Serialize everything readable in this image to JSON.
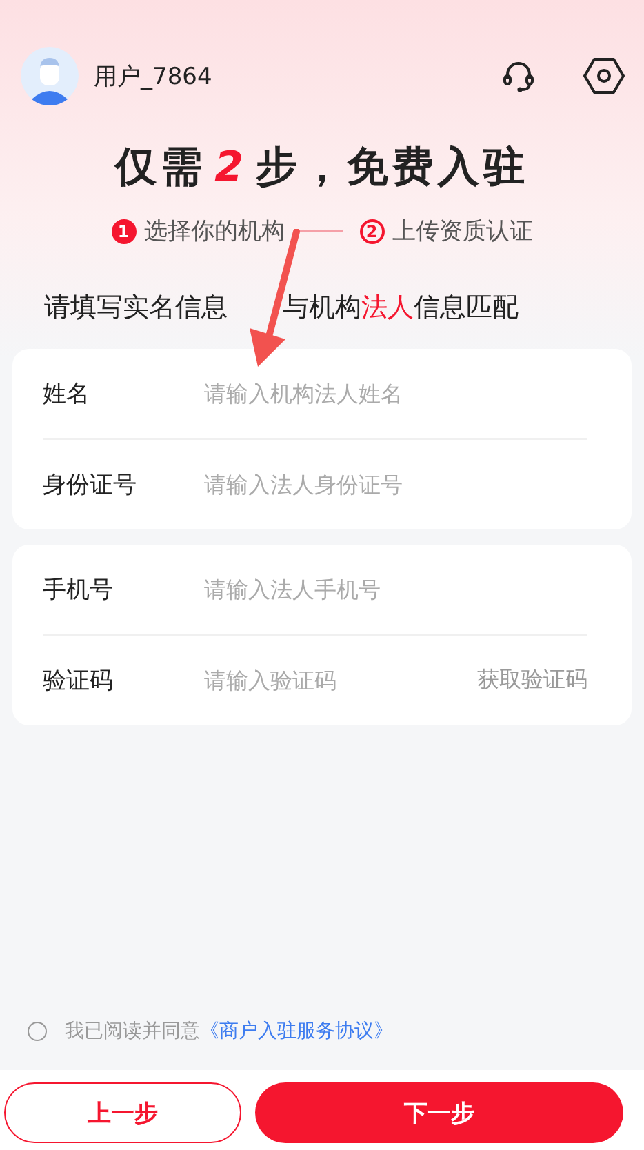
{
  "header": {
    "username": "用户_7864"
  },
  "title": {
    "before": "仅需",
    "number": "2",
    "after": "步，免费入驻"
  },
  "steps": [
    {
      "number": "1",
      "label": "选择你的机构",
      "selected": true
    },
    {
      "number": "2",
      "label": "上传资质认证",
      "selected": false
    }
  ],
  "instruction": [
    {
      "text": "请填写实名信息",
      "highlight": false
    },
    {
      "text": "与机构",
      "highlight": false
    },
    {
      "text": "法人",
      "highlight": true
    },
    {
      "text": "信息匹配",
      "highlight": false
    }
  ],
  "form_groups": [
    {
      "fields": [
        {
          "label": "姓名",
          "placeholder": "请输入机构法人姓名"
        },
        {
          "label": "身份证号",
          "placeholder": "请输入法人身份证号"
        }
      ]
    },
    {
      "fields": [
        {
          "label": "手机号",
          "placeholder": "请输入法人手机号"
        },
        {
          "label": "验证码",
          "placeholder": "请输入验证码",
          "action": "获取验证码"
        }
      ]
    }
  ],
  "agreement": {
    "checked": false,
    "text": "我已阅读并同意",
    "link": "《商户入驻服务协议》"
  },
  "buttons": [
    {
      "label": "上一步",
      "kind": "secondary"
    },
    {
      "label": "下一步",
      "kind": "primary"
    }
  ]
}
